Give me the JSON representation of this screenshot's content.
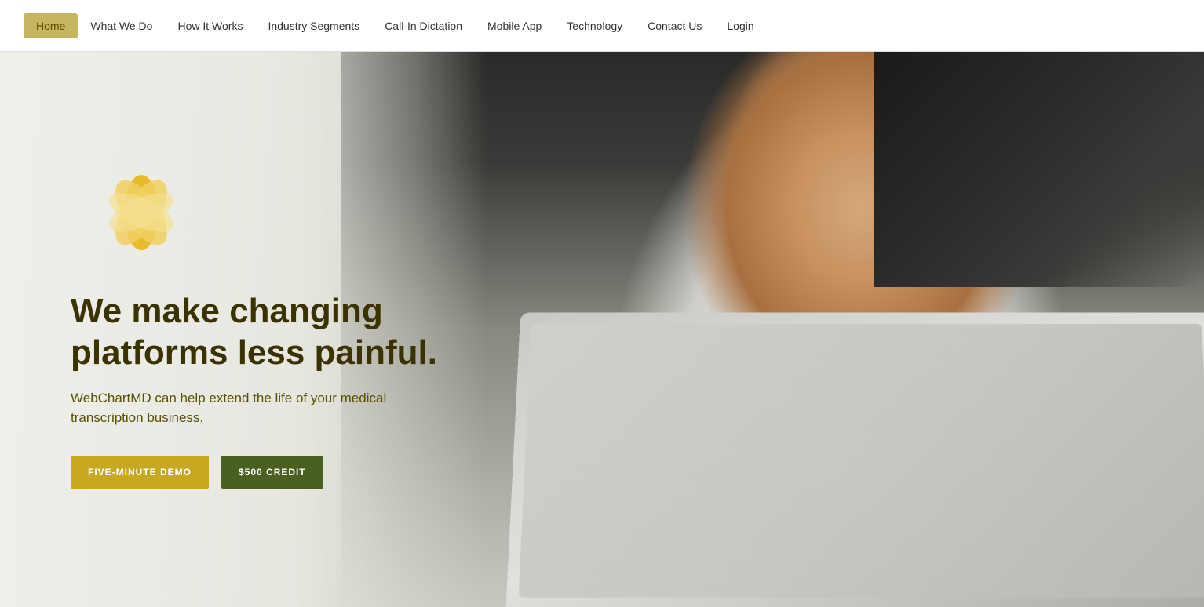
{
  "nav": {
    "items": [
      {
        "label": "Home",
        "active": true
      },
      {
        "label": "What We Do",
        "active": false
      },
      {
        "label": "How It Works",
        "active": false
      },
      {
        "label": "Industry Segments",
        "active": false
      },
      {
        "label": "Call-In Dictation",
        "active": false
      },
      {
        "label": "Mobile App",
        "active": false
      },
      {
        "label": "Technology",
        "active": false
      },
      {
        "label": "Contact Us",
        "active": false
      },
      {
        "label": "Login",
        "active": false
      }
    ]
  },
  "hero": {
    "headline": "We make changing platforms less painful.",
    "subtext": "WebChartMD can help extend the life of your medical transcription business.",
    "btn_demo": "FIVE-MINUTE DEMO",
    "btn_credit": "$500 CREDIT"
  },
  "colors": {
    "nav_active_bg": "#c8b560",
    "nav_active_text": "#5a4a00",
    "headline_color": "#3a3200",
    "sub_color": "#5a5000",
    "btn_demo_bg": "#c8a820",
    "btn_credit_bg": "#4a6020"
  }
}
